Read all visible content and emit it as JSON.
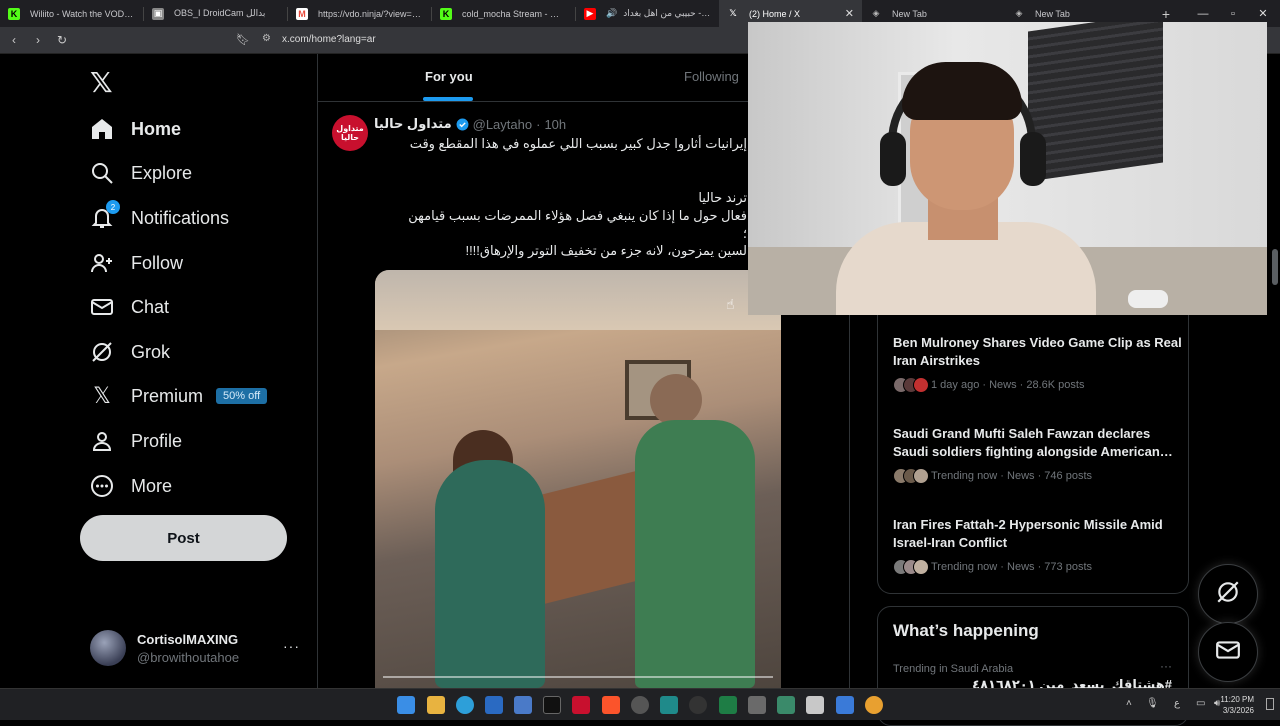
{
  "browser": {
    "tabs": [
      {
        "label": "Wiliito - Watch the VOD on Ki",
        "favicon_color": "#53fc18",
        "favicon": "K"
      },
      {
        "label": "OBS_I DroidCam بدالل",
        "favicon_color": "#888888",
        "favicon": "▣"
      },
      {
        "label": "https://vdo.ninja/?view=much",
        "favicon_color": "#e84a3c",
        "favicon": "M"
      },
      {
        "label": "cold_mocha Stream - Watch Li",
        "favicon_color": "#53fc18",
        "favicon": "K"
      },
      {
        "label": "حبيبي من اهل بغداد - by",
        "favicon_color": "#ff0000",
        "favicon": "▶"
      },
      {
        "label": "(2) Home / X",
        "favicon_color": "#000000",
        "favicon": "X",
        "active": true
      },
      {
        "label": "New Tab",
        "favicon_color": "#555555",
        "favicon": "◈"
      },
      {
        "label": "New Tab",
        "favicon_color": "#555555",
        "favicon": "◈"
      }
    ],
    "url": "x.com/home?lang=ar"
  },
  "nav": {
    "items": [
      {
        "label": "Home",
        "icon": "home-icon",
        "active": true
      },
      {
        "label": "Explore",
        "icon": "search-icon"
      },
      {
        "label": "Notifications",
        "icon": "bell-icon",
        "badge": "2"
      },
      {
        "label": "Follow",
        "icon": "follow-icon"
      },
      {
        "label": "Chat",
        "icon": "mail-icon"
      },
      {
        "label": "Grok",
        "icon": "grok-icon"
      },
      {
        "label": "Premium",
        "icon": "x-icon",
        "promo": "50% off"
      },
      {
        "label": "Profile",
        "icon": "person-icon"
      },
      {
        "label": "More",
        "icon": "more-circle-icon"
      }
    ],
    "post_label": "Post",
    "account": {
      "display_name": "CortisolMAXING",
      "handle": "@browithoutahoe",
      "more": "···"
    }
  },
  "feed": {
    "tabs": {
      "for_you": "For you",
      "following": "Following"
    },
    "post": {
      "avatar_text": "متداول حاليا",
      "name": "متداول حاليا",
      "handle": "@Laytaho",
      "dot": "·",
      "time": "10h",
      "lines": [
        "إيرانيات أثاروا جدل كبير بسبب اللي عملوه في هذا المقطع وقت",
        "ترند حاليا",
        "فعال حول ما إذا كان ينبغي فصل هؤلاء الممرضات بسبب قيامهن",
        "؛",
        "لسين يمزحون، لانه جزء من تخفيف التوتر والإرهاق!!!!"
      ]
    }
  },
  "sidebar": {
    "trends": [
      {
        "title": "Ben Mulroney Shares Video Game Clip as Real Iran Airstrikes",
        "meta": "1 day ago · News · 28.6K posts"
      },
      {
        "title": "Saudi Grand Mufti Saleh Fawzan declares Saudi soldiers fighting alongside American…",
        "meta": "Trending now · News · 746 posts"
      },
      {
        "title": "Iran Fires Fattah-2 Hypersonic Missile Amid Israel-Iran Conflict",
        "meta": "Trending now · News · 773 posts"
      }
    ],
    "happening": {
      "title": "What’s happening",
      "subtitle": "Trending in Saudi Arabia",
      "more": "···",
      "trend": "#هشتاقك_يسعد_مين ٤٨١٦٨٢٠١"
    }
  },
  "taskbar": {
    "time": "11:20 PM",
    "date": "3/3/2026",
    "lang": "ع"
  },
  "colors": {
    "accent": "#1d9bf0",
    "bg": "#000000",
    "muted": "#71767b"
  }
}
